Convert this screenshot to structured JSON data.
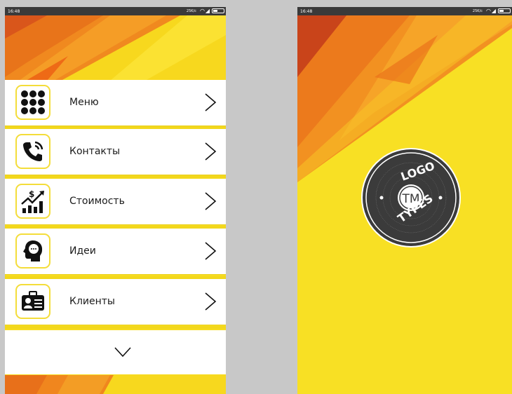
{
  "left_screen": {
    "status": {
      "time": "16:48",
      "net": "25K/c"
    },
    "menu": [
      {
        "label": "Меню",
        "icon": "grid-icon"
      },
      {
        "label": "Контакты",
        "icon": "phone-call-icon"
      },
      {
        "label": "Стоимость",
        "icon": "price-chart-icon"
      },
      {
        "label": "Идеи",
        "icon": "idea-head-icon"
      },
      {
        "label": "Клиенты",
        "icon": "client-card-icon"
      }
    ],
    "more_icon": "chevron-down-icon"
  },
  "right_screen": {
    "status": {
      "time": "16:48",
      "net": "25K/c"
    },
    "logo": {
      "top": "LOGO",
      "bottom": "TYPES",
      "center": "TM"
    }
  },
  "colors": {
    "yellow": "#f8e024",
    "orange": "#f0821e",
    "dark_orange": "#e25f0f",
    "icon_border": "#f4dd3a",
    "divider": "#f2d71c"
  }
}
